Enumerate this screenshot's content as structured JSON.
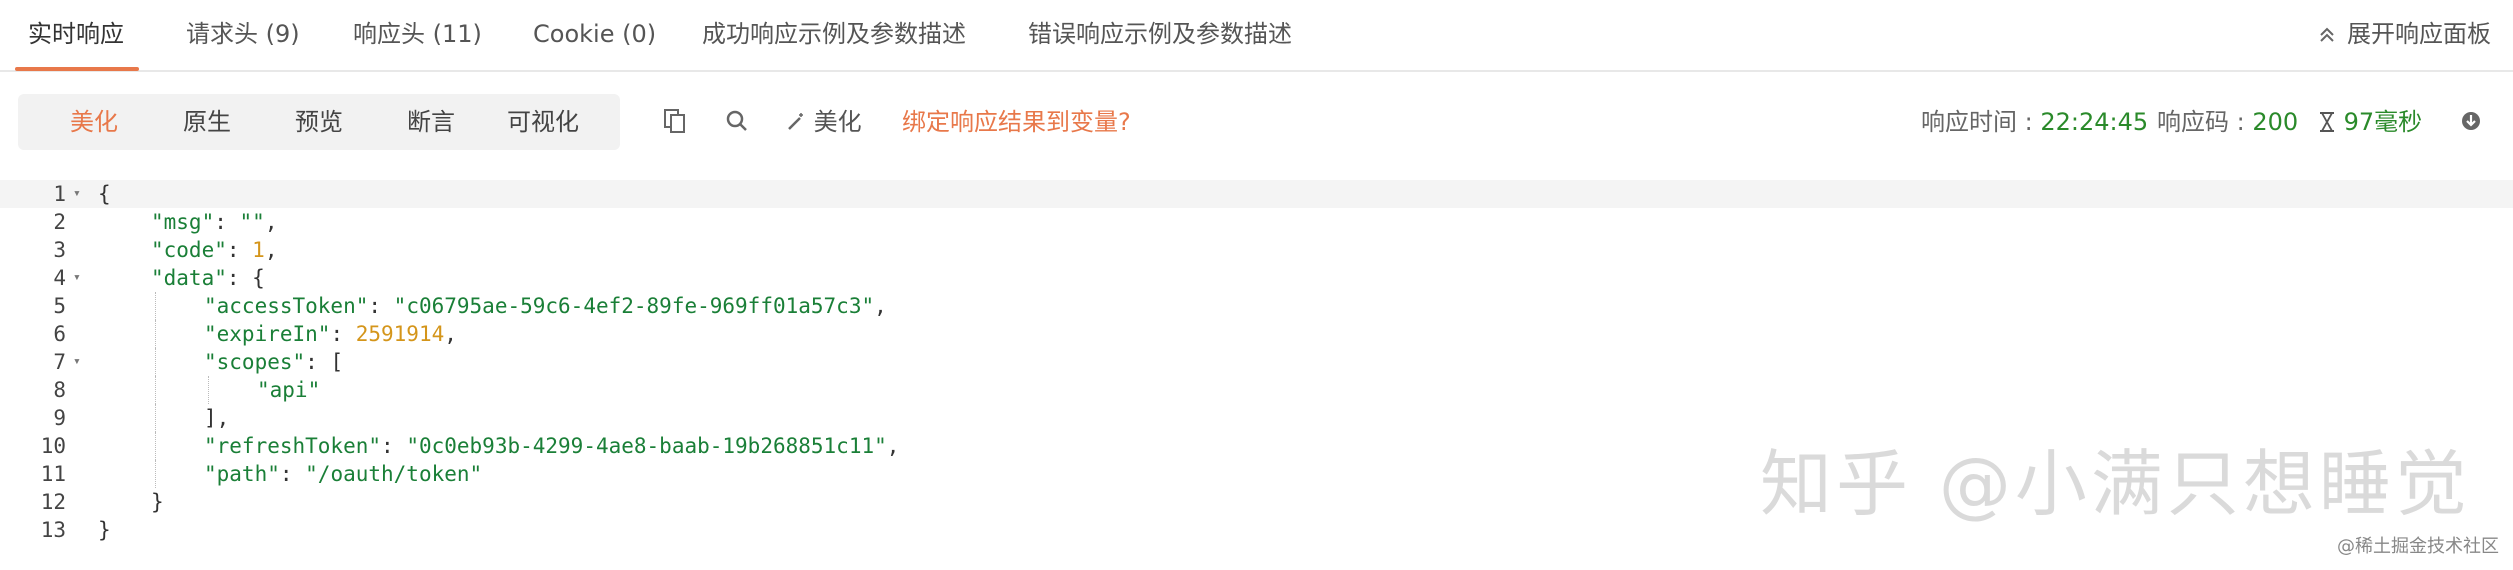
{
  "tabs": [
    {
      "label": "实时响应",
      "active": true
    },
    {
      "label": "请求头 (9)",
      "active": false
    },
    {
      "label": "响应头 (11)",
      "active": false
    },
    {
      "label": "Cookie (0)",
      "active": false
    },
    {
      "label": "成功响应示例及参数描述",
      "active": false
    },
    {
      "label": "错误响应示例及参数描述",
      "active": false
    }
  ],
  "expand_label": "展开响应面板",
  "view_modes": [
    {
      "label": "美化",
      "active": true
    },
    {
      "label": "原生",
      "active": false
    },
    {
      "label": "预览",
      "active": false
    },
    {
      "label": "断言",
      "active": false
    },
    {
      "label": "可视化",
      "active": false
    }
  ],
  "toolbar": {
    "copy_icon": "copy-icon",
    "search_icon": "search-icon",
    "beautify_label": "美化",
    "bind_link": "绑定响应结果到变量?"
  },
  "response_meta": {
    "time_label": "响应时间 : ",
    "time_value": "22:24:45",
    "code_label": "响应码 : ",
    "code_value": "200",
    "duration_value": "97毫秒"
  },
  "colors": {
    "accent": "#e8784a",
    "json_key": "#1a7f37",
    "json_number": "#d4951a"
  },
  "code_lines": [
    {
      "num": "1",
      "fold": true,
      "indent": 0,
      "parts": [
        [
          "p",
          "{"
        ]
      ]
    },
    {
      "num": "2",
      "fold": false,
      "indent": 1,
      "parts": [
        [
          "k",
          "\"msg\""
        ],
        [
          "p",
          ": "
        ],
        [
          "s",
          "\"\""
        ],
        [
          "p",
          ","
        ]
      ]
    },
    {
      "num": "3",
      "fold": false,
      "indent": 1,
      "parts": [
        [
          "k",
          "\"code\""
        ],
        [
          "p",
          ": "
        ],
        [
          "n",
          "1"
        ],
        [
          "p",
          ","
        ]
      ]
    },
    {
      "num": "4",
      "fold": true,
      "indent": 1,
      "parts": [
        [
          "k",
          "\"data\""
        ],
        [
          "p",
          ": {"
        ]
      ]
    },
    {
      "num": "5",
      "fold": false,
      "indent": 2,
      "parts": [
        [
          "k",
          "\"accessToken\""
        ],
        [
          "p",
          ": "
        ],
        [
          "s",
          "\"c06795ae-59c6-4ef2-89fe-969ff01a57c3\""
        ],
        [
          "p",
          ","
        ]
      ]
    },
    {
      "num": "6",
      "fold": false,
      "indent": 2,
      "parts": [
        [
          "k",
          "\"expireIn\""
        ],
        [
          "p",
          ": "
        ],
        [
          "n",
          "2591914"
        ],
        [
          "p",
          ","
        ]
      ]
    },
    {
      "num": "7",
      "fold": true,
      "indent": 2,
      "parts": [
        [
          "k",
          "\"scopes\""
        ],
        [
          "p",
          ": ["
        ]
      ]
    },
    {
      "num": "8",
      "fold": false,
      "indent": 3,
      "parts": [
        [
          "s",
          "\"api\""
        ]
      ]
    },
    {
      "num": "9",
      "fold": false,
      "indent": 2,
      "parts": [
        [
          "p",
          "],"
        ]
      ]
    },
    {
      "num": "10",
      "fold": false,
      "indent": 2,
      "parts": [
        [
          "k",
          "\"refreshToken\""
        ],
        [
          "p",
          ": "
        ],
        [
          "s",
          "\"0c0eb93b-4299-4ae8-baab-19b268851c11\""
        ],
        [
          "p",
          ","
        ]
      ]
    },
    {
      "num": "11",
      "fold": false,
      "indent": 2,
      "parts": [
        [
          "k",
          "\"path\""
        ],
        [
          "p",
          ": "
        ],
        [
          "s",
          "\"/oauth/token\""
        ]
      ]
    },
    {
      "num": "12",
      "fold": false,
      "indent": 1,
      "parts": [
        [
          "p",
          "}"
        ]
      ]
    },
    {
      "num": "13",
      "fold": false,
      "indent": 0,
      "parts": [
        [
          "p",
          "}"
        ]
      ]
    }
  ],
  "watermark": "知乎 @小满只想睡觉",
  "watermark_small": "@稀土掘金技术社区"
}
